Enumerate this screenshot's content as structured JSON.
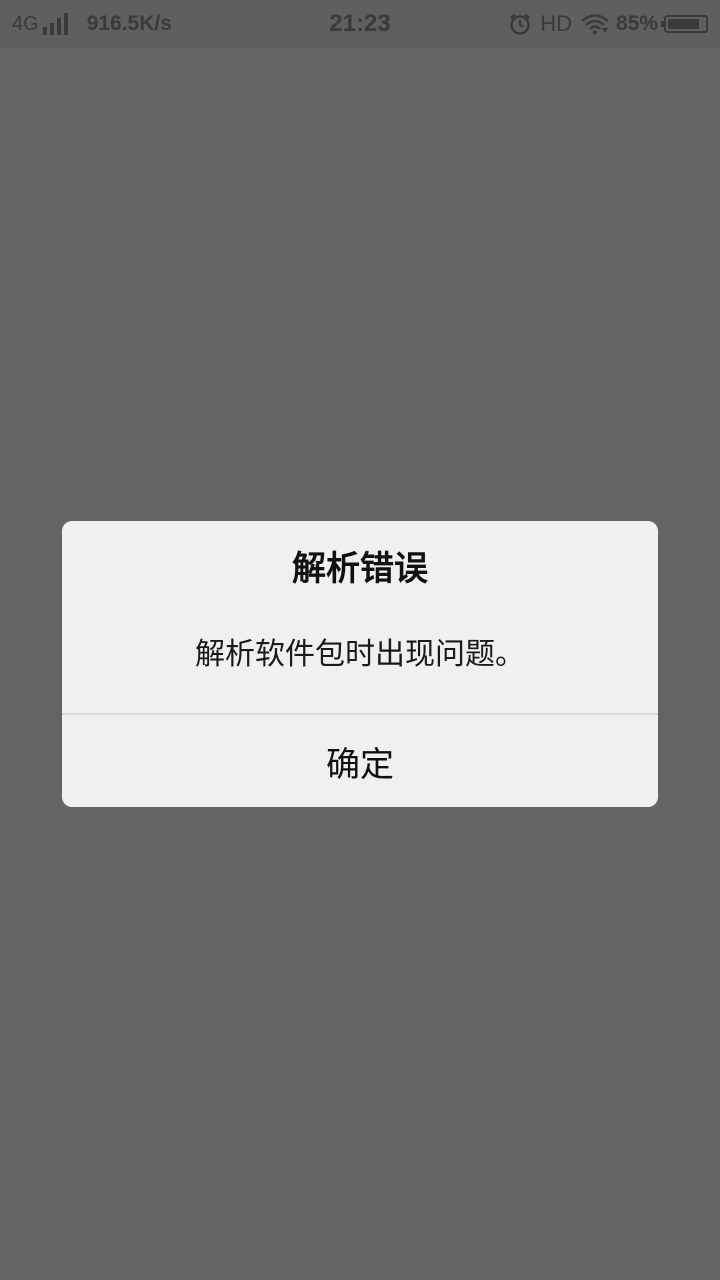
{
  "status_bar": {
    "network_type": "4G",
    "signal_icon": "signal-bars-icon",
    "net_speed": "916.5K/s",
    "time": "21:23",
    "alarm_icon": "alarm-clock-icon",
    "hd_label": "HD",
    "wifi_icon": "wifi-icon",
    "battery_percent": "85%",
    "battery_level": 0.85,
    "battery_icon": "battery-icon",
    "color": "#3a3a3a"
  },
  "dialog": {
    "title": "解析错误",
    "message": "解析软件包时出现问题。",
    "confirm_label": "确定",
    "background": "#f0f0f0"
  },
  "overlay_color": "#646464"
}
